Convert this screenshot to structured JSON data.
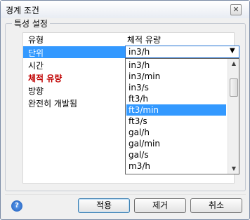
{
  "window": {
    "title": "경계 조건",
    "close_label": "✕"
  },
  "group": {
    "label": "특성 설정"
  },
  "grid": {
    "header": {
      "property": "유형",
      "value": "체적 유량"
    },
    "rows": [
      {
        "label": "단위"
      },
      {
        "label": "시간"
      },
      {
        "label": "체적 유량"
      },
      {
        "label": "방향"
      },
      {
        "label": "완전히 개발됨"
      }
    ]
  },
  "unit_combo": {
    "value": "in3/h",
    "arrow": "▼"
  },
  "unit_options": {
    "items": [
      "in3/h",
      "in3/min",
      "in3/s",
      "ft3/h",
      "ft3/min",
      "ft3/s",
      "gal/h",
      "gal/min",
      "gal/s",
      "m3/h"
    ],
    "selected": "ft3/min",
    "scroll_up": "▲",
    "scroll_down": "▼"
  },
  "footer": {
    "help": "?",
    "apply": "적용",
    "remove": "제거",
    "cancel": "취소"
  }
}
